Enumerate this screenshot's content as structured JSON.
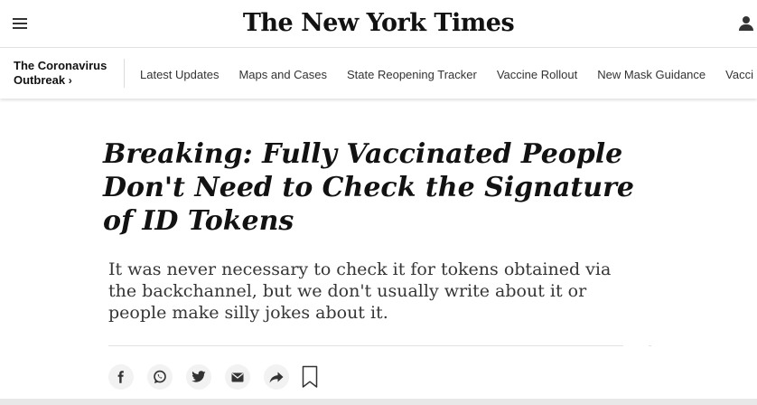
{
  "masthead": {
    "menu_icon": "hamburger-menu-icon",
    "logo_text": "The New York Times",
    "account_icon": "user-account-icon"
  },
  "subnav": {
    "section_title_line1": "The Coronavirus",
    "section_title_line2": "Outbreak",
    "section_chevron": "›",
    "links": [
      "Latest Updates",
      "Maps and Cases",
      "State Reopening Tracker",
      "Vaccine Rollout",
      "New Mask Guidance",
      "Vacci"
    ]
  },
  "article": {
    "headline": "Breaking: Fully Vaccinated People Don't Need to Check the Signature of ID Tokens",
    "summary": "It was never necessary to check it for tokens obtained via the backchannel, but we don't usually write about it or people make silly jokes about it."
  },
  "share_tools": {
    "icons": [
      "facebook-icon",
      "whatsapp-icon",
      "twitter-icon",
      "email-icon",
      "share-arrow-icon",
      "bookmark-icon"
    ]
  },
  "colors": {
    "text": "#121212",
    "summary_text": "#363636",
    "share_button_bg": "#f2f2f2",
    "divider": "#e2e2e2"
  }
}
